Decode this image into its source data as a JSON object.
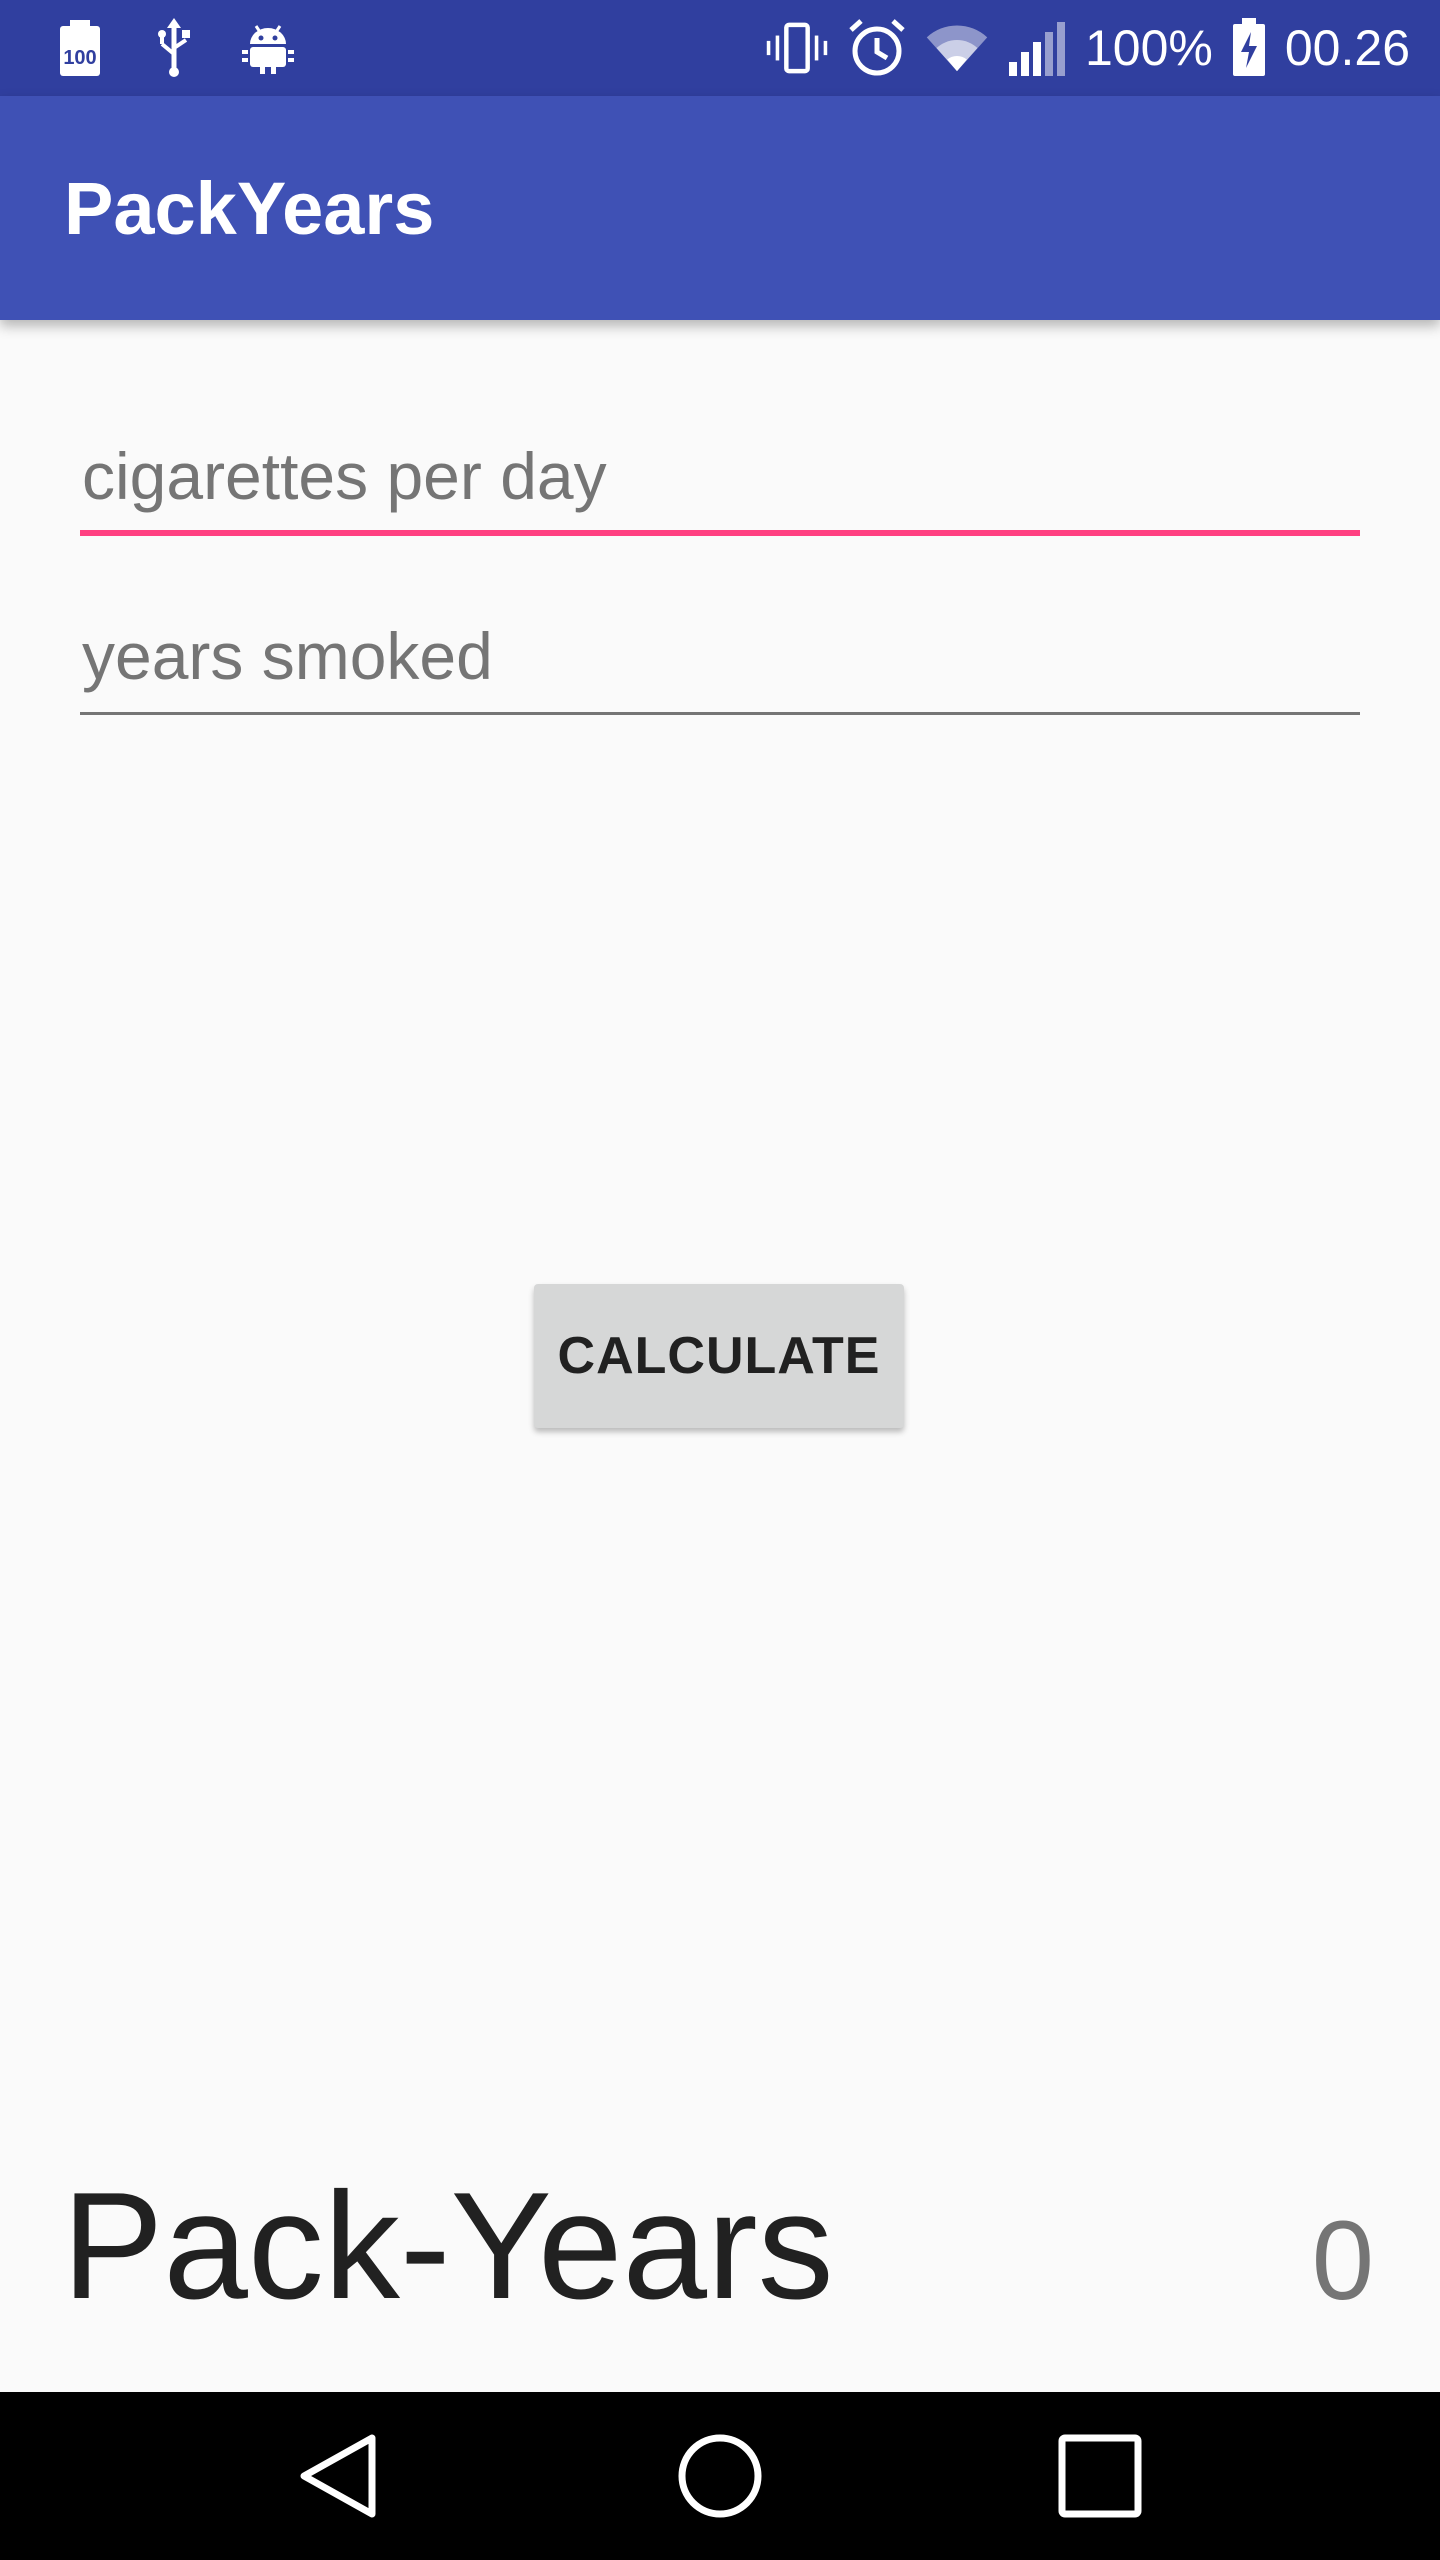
{
  "status_bar": {
    "battery_percent": "100%",
    "time": "00.26",
    "icons_left": [
      "battery-saver-100-icon",
      "usb-icon",
      "android-debug-icon"
    ],
    "icons_right": [
      "vibrate-icon",
      "alarm-icon",
      "wifi-icon",
      "signal-icon",
      "battery-charging-icon"
    ]
  },
  "app_bar": {
    "title": "PackYears",
    "color": "#3f51b5"
  },
  "form": {
    "cigarettes_placeholder": "cigarettes per day",
    "cigarettes_value": "",
    "years_placeholder": "years smoked",
    "years_value": "",
    "accent_color": "#ff4081"
  },
  "actions": {
    "calculate_label": "CALCULATE"
  },
  "result": {
    "label": "Pack-Years",
    "value": "0"
  },
  "nav_bar": {
    "icons": [
      "back-icon",
      "home-icon",
      "recents-icon"
    ]
  }
}
